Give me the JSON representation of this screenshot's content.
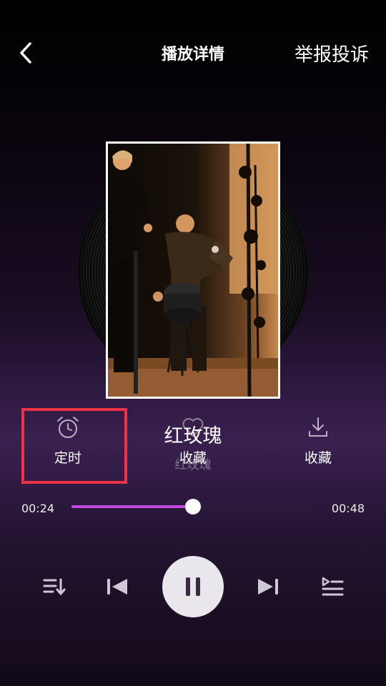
{
  "header": {
    "title": "播放详情",
    "report_label": "举报投诉"
  },
  "song": {
    "title": "红玫瑰",
    "artist": "红玫瑰"
  },
  "actions": {
    "timer_label": "定时",
    "favorite_label": "收藏",
    "download_label": "收藏"
  },
  "progress": {
    "current": "00:24",
    "total": "00:48",
    "fraction": 0.5
  },
  "colors": {
    "accent": "#c046e0",
    "highlight": "#ee3344"
  },
  "icons": [
    "back-icon",
    "alarm-clock-icon",
    "heart-icon",
    "download-icon",
    "playlist-icon",
    "previous-icon",
    "pause-icon",
    "next-icon",
    "queue-icon"
  ]
}
